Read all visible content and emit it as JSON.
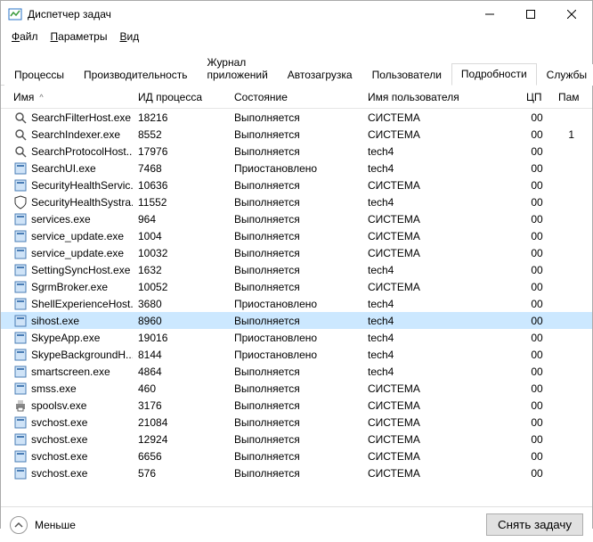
{
  "window": {
    "title": "Диспетчер задач"
  },
  "menu": {
    "file": "Файл",
    "options": "Параметры",
    "view": "Вид"
  },
  "tabs": {
    "processes": "Процессы",
    "performance": "Производительность",
    "app_history": "Журнал приложений",
    "startup": "Автозагрузка",
    "users": "Пользователи",
    "details": "Подробности",
    "services": "Службы",
    "active": "details"
  },
  "columns": {
    "name": "Имя",
    "pid": "ИД процесса",
    "state": "Состояние",
    "user": "Имя пользователя",
    "cpu": "ЦП",
    "mem": "Пам"
  },
  "states": {
    "running": "Выполняется",
    "suspended": "Приостановлено"
  },
  "users": {
    "system": "СИСТЕМА",
    "tech4": "tech4"
  },
  "icons": {
    "app": "app-icon",
    "generic": "generic-exe-icon",
    "search": "search-icon",
    "shield": "shield-icon",
    "printer": "printer-icon"
  },
  "rows": [
    {
      "name": "SearchFilterHost.exe",
      "pid": "18216",
      "state_key": "running",
      "user_key": "system",
      "cpu": "00",
      "mem": "",
      "icon": "search",
      "selected": false
    },
    {
      "name": "SearchIndexer.exe",
      "pid": "8552",
      "state_key": "running",
      "user_key": "system",
      "cpu": "00",
      "mem": "1",
      "icon": "search",
      "selected": false
    },
    {
      "name": "SearchProtocolHost...",
      "pid": "17976",
      "state_key": "running",
      "user_key": "tech4",
      "cpu": "00",
      "mem": "",
      "icon": "search",
      "selected": false
    },
    {
      "name": "SearchUI.exe",
      "pid": "7468",
      "state_key": "suspended",
      "user_key": "tech4",
      "cpu": "00",
      "mem": "",
      "icon": "generic",
      "selected": false
    },
    {
      "name": "SecurityHealthServic...",
      "pid": "10636",
      "state_key": "running",
      "user_key": "system",
      "cpu": "00",
      "mem": "",
      "icon": "generic",
      "selected": false
    },
    {
      "name": "SecurityHealthSystra...",
      "pid": "11552",
      "state_key": "running",
      "user_key": "tech4",
      "cpu": "00",
      "mem": "",
      "icon": "shield",
      "selected": false
    },
    {
      "name": "services.exe",
      "pid": "964",
      "state_key": "running",
      "user_key": "system",
      "cpu": "00",
      "mem": "",
      "icon": "generic",
      "selected": false
    },
    {
      "name": "service_update.exe",
      "pid": "1004",
      "state_key": "running",
      "user_key": "system",
      "cpu": "00",
      "mem": "",
      "icon": "generic",
      "selected": false
    },
    {
      "name": "service_update.exe",
      "pid": "10032",
      "state_key": "running",
      "user_key": "system",
      "cpu": "00",
      "mem": "",
      "icon": "generic",
      "selected": false
    },
    {
      "name": "SettingSyncHost.exe",
      "pid": "1632",
      "state_key": "running",
      "user_key": "tech4",
      "cpu": "00",
      "mem": "",
      "icon": "generic",
      "selected": false
    },
    {
      "name": "SgrmBroker.exe",
      "pid": "10052",
      "state_key": "running",
      "user_key": "system",
      "cpu": "00",
      "mem": "",
      "icon": "generic",
      "selected": false
    },
    {
      "name": "ShellExperienceHost....",
      "pid": "3680",
      "state_key": "suspended",
      "user_key": "tech4",
      "cpu": "00",
      "mem": "",
      "icon": "generic",
      "selected": false
    },
    {
      "name": "sihost.exe",
      "pid": "8960",
      "state_key": "running",
      "user_key": "tech4",
      "cpu": "00",
      "mem": "",
      "icon": "generic",
      "selected": true
    },
    {
      "name": "SkypeApp.exe",
      "pid": "19016",
      "state_key": "suspended",
      "user_key": "tech4",
      "cpu": "00",
      "mem": "",
      "icon": "generic",
      "selected": false
    },
    {
      "name": "SkypeBackgroundH...",
      "pid": "8144",
      "state_key": "suspended",
      "user_key": "tech4",
      "cpu": "00",
      "mem": "",
      "icon": "generic",
      "selected": false
    },
    {
      "name": "smartscreen.exe",
      "pid": "4864",
      "state_key": "running",
      "user_key": "tech4",
      "cpu": "00",
      "mem": "",
      "icon": "generic",
      "selected": false
    },
    {
      "name": "smss.exe",
      "pid": "460",
      "state_key": "running",
      "user_key": "system",
      "cpu": "00",
      "mem": "",
      "icon": "generic",
      "selected": false
    },
    {
      "name": "spoolsv.exe",
      "pid": "3176",
      "state_key": "running",
      "user_key": "system",
      "cpu": "00",
      "mem": "",
      "icon": "printer",
      "selected": false
    },
    {
      "name": "svchost.exe",
      "pid": "21084",
      "state_key": "running",
      "user_key": "system",
      "cpu": "00",
      "mem": "",
      "icon": "generic",
      "selected": false
    },
    {
      "name": "svchost.exe",
      "pid": "12924",
      "state_key": "running",
      "user_key": "system",
      "cpu": "00",
      "mem": "",
      "icon": "generic",
      "selected": false
    },
    {
      "name": "svchost.exe",
      "pid": "6656",
      "state_key": "running",
      "user_key": "system",
      "cpu": "00",
      "mem": "",
      "icon": "generic",
      "selected": false
    },
    {
      "name": "svchost.exe",
      "pid": "576",
      "state_key": "running",
      "user_key": "system",
      "cpu": "00",
      "mem": "",
      "icon": "generic",
      "selected": false
    }
  ],
  "footer": {
    "fewer": "Меньше",
    "end_task": "Снять задачу"
  }
}
